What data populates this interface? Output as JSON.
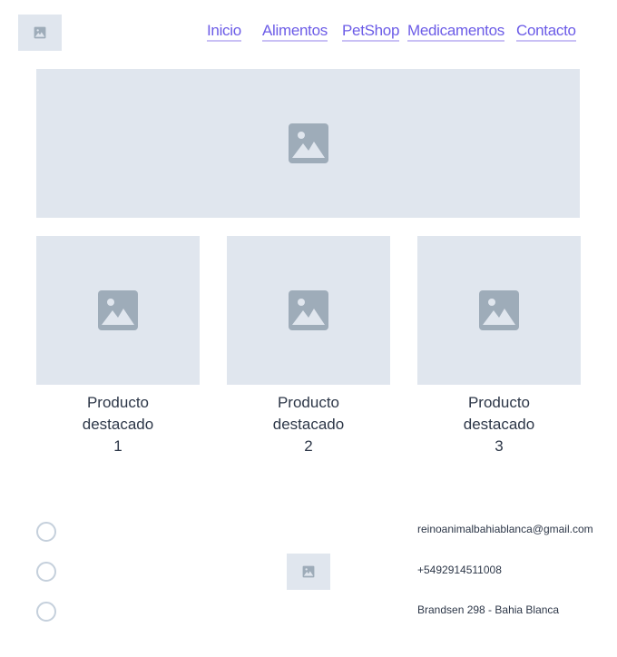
{
  "nav": {
    "items": [
      "Inicio",
      "Alimentos",
      "PetShop",
      "Medicamentos",
      "Contacto"
    ]
  },
  "products": [
    "Producto destacado 1",
    "Producto destacado 2",
    "Producto destacado 3"
  ],
  "footer": {
    "email": "reinoanimalbahiablanca@gmail.com",
    "phone": "+5492914511008",
    "address": "Brandsen 298 - Bahia Blanca"
  },
  "colors": {
    "accent": "#6c5ce7",
    "placeholder_bg": "#e0e6ee",
    "placeholder_icon": "#9eacb9"
  }
}
